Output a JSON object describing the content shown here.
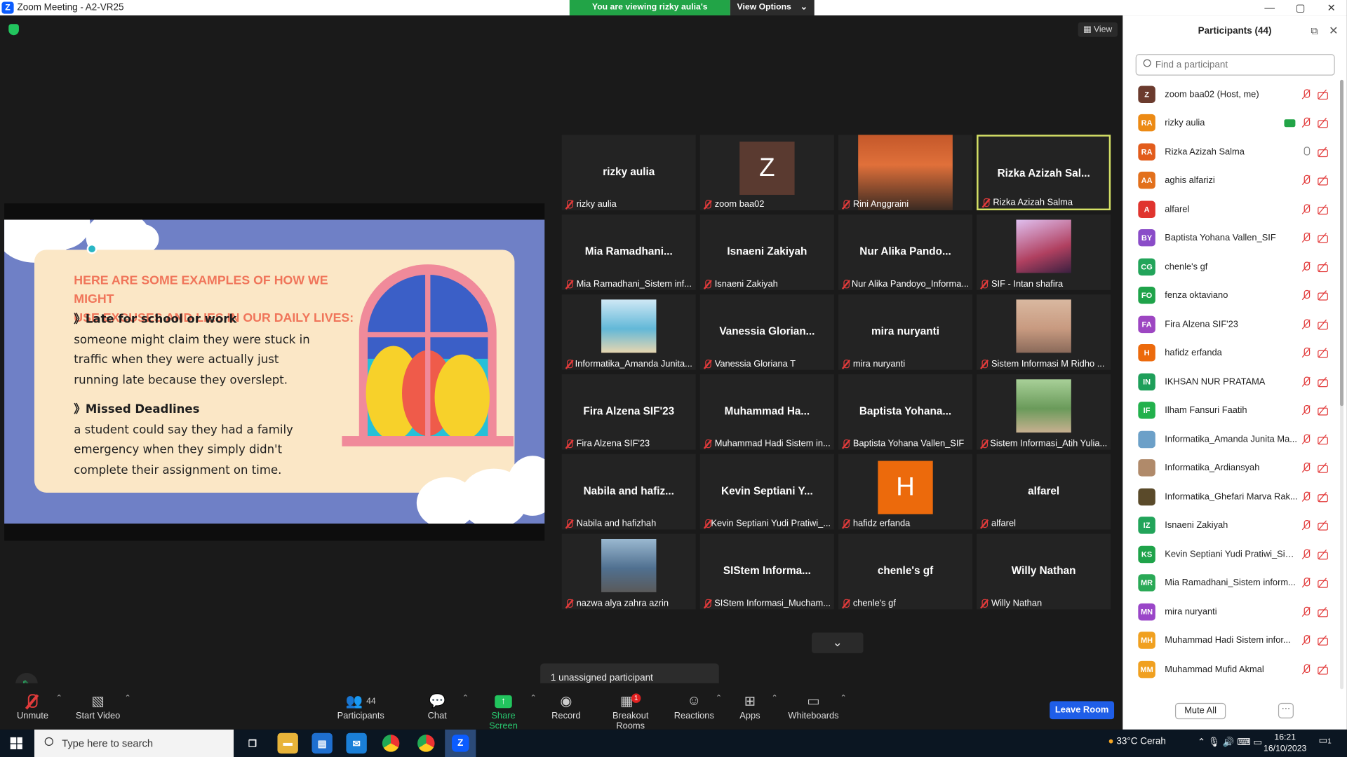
{
  "window": {
    "title": "Zoom Meeting - A2-VR25",
    "min": "—",
    "max": "▢",
    "close": "✕"
  },
  "banner": {
    "viewing": "You are viewing rizky aulia's screen",
    "view_options": "View Options",
    "caret": "⌄"
  },
  "view_button": "View",
  "slide": {
    "heading_line1": "HERE ARE SOME EXAMPLES OF HOW WE MIGHT",
    "heading_line2": "USE EXCUSES AND LIES IN OUR DAILY LIVES:",
    "point1_title": "》Late for school or work",
    "point1_l1": "someone might claim they were stuck in",
    "point1_l2": "traffic when they were actually just",
    "point1_l3": "running late because they overslept.",
    "point2_title": "》Missed Deadlines",
    "point2_l1": "a student could say they had a family",
    "point2_l2": "emergency when they simply didn't",
    "point2_l3": "complete their assignment on time."
  },
  "tiles": [
    {
      "big": "rizky aulia",
      "label": "rizky aulia"
    },
    {
      "big": "Z",
      "label": "zoom baa02",
      "avatar_color": "#5a3a30"
    },
    {
      "big": "",
      "label": "Rini Anggraini",
      "photo": "room"
    },
    {
      "big": "Rizka Azizah Sal...",
      "label": "Rizka Azizah Salma",
      "active": true
    },
    {
      "big": "Mia  Ramadhani...",
      "label": "Mia Ramadhani_Sistem inf..."
    },
    {
      "big": "Isnaeni Zakiyah",
      "label": "Isnaeni Zakiyah"
    },
    {
      "big": "Nur Alika Pando...",
      "label": "Nur Alika Pandoyo_Informa..."
    },
    {
      "big": "",
      "label": "SIF - Intan shafira",
      "photo": "anime"
    },
    {
      "big": "",
      "label": "Informatika_Amanda Junita...",
      "photo": "beach"
    },
    {
      "big": "Vanessia  Glorian...",
      "label": "Vanessia Gloriana T"
    },
    {
      "big": "mira nuryanti",
      "label": "mira nuryanti"
    },
    {
      "big": "",
      "label": "Sistem Informasi M Ridho ...",
      "photo": "portrait"
    },
    {
      "big": "Fira Alzena SIF'23",
      "label": "Fira Alzena SIF'23"
    },
    {
      "big": "Muhammad  Ha...",
      "label": "Muhammad Hadi Sistem in..."
    },
    {
      "big": "Baptista Yohana...",
      "label": "Baptista Yohana Vallen_SIF"
    },
    {
      "big": "",
      "label": "Sistem Informasi_Atih Yulia...",
      "photo": "park"
    },
    {
      "big": "Nabila  and  hafiz...",
      "label": "Nabila and hafizhah"
    },
    {
      "big": "Kevin Septiani Y...",
      "label": "Kevin Septiani Yudi Pratiwi_..."
    },
    {
      "big": "H",
      "label": "hafidz erfanda",
      "avatar_color": "#ec6a0c"
    },
    {
      "big": "alfarel",
      "label": "alfarel"
    },
    {
      "big": "",
      "label": "nazwa alya zahra azrin",
      "photo": "car"
    },
    {
      "big": "SIStem  Informa...",
      "label": "SIStem Informasi_Mucham..."
    },
    {
      "big": "chenle's gf",
      "label": "chenle's gf"
    },
    {
      "big": "Willy Nathan",
      "label": "Willy Nathan"
    }
  ],
  "grid_more": "⌄",
  "unassigned": "1 unassigned participant",
  "toolbar": {
    "unmute": "Unmute",
    "start_video": "Start Video",
    "participants": "Participants",
    "participants_count": "44",
    "chat": "Chat",
    "share_screen": "Share Screen",
    "record": "Record",
    "breakout": "Breakout Rooms",
    "breakout_badge": "1",
    "reactions": "Reactions",
    "apps": "Apps",
    "whiteboards": "Whiteboards",
    "leave": "Leave Room",
    "caret": "⌃"
  },
  "panel": {
    "title": "Participants (44)",
    "search_placeholder": "Find a participant",
    "mute_all": "Mute All",
    "more": "···",
    "participants": [
      {
        "initials": "Z",
        "name": "zoom baa02 (Host, me)",
        "color": "#6b3b2e"
      },
      {
        "initials": "RA",
        "name": "rizky aulia",
        "color": "#ec8a14",
        "sharing": true
      },
      {
        "initials": "RA",
        "name": "Rizka Azizah Salma",
        "color": "#e25c1c",
        "mic_on": true
      },
      {
        "initials": "AA",
        "name": "aghis alfarizi",
        "color": "#e2701c"
      },
      {
        "initials": "A",
        "name": "alfarel",
        "color": "#e0342e"
      },
      {
        "initials": "BY",
        "name": "Baptista Yohana Vallen_SIF",
        "color": "#8a4cc8"
      },
      {
        "initials": "CG",
        "name": "chenle's gf",
        "color": "#22a45a"
      },
      {
        "initials": "FO",
        "name": "fenza oktaviano",
        "color": "#1fa34a"
      },
      {
        "initials": "FA",
        "name": "Fira Alzena SIF'23",
        "color": "#9d46c2"
      },
      {
        "initials": "H",
        "name": "hafidz erfanda",
        "color": "#ec6a0c"
      },
      {
        "initials": "IN",
        "name": "IKHSAN NUR PRATAMA",
        "color": "#1e9f5a"
      },
      {
        "initials": "IF",
        "name": "Ilham Fansuri Faatih",
        "color": "#22b14c"
      },
      {
        "initials": "",
        "name": "Informatika_Amanda Junita Ma...",
        "color": "#6ca0c8"
      },
      {
        "initials": "",
        "name": "Informatika_Ardiansyah",
        "color": "#b08a6a"
      },
      {
        "initials": "",
        "name": "Informatika_Ghefari Marva Rak...",
        "color": "#5a4a2a"
      },
      {
        "initials": "IZ",
        "name": "Isnaeni Zakiyah",
        "color": "#22a45a"
      },
      {
        "initials": "KS",
        "name": "Kevin Septiani Yudi Pratiwi_Sist...",
        "color": "#1fa34a"
      },
      {
        "initials": "MR",
        "name": "Mia Ramadhani_Sistem inform...",
        "color": "#2aa956"
      },
      {
        "initials": "MN",
        "name": "mira nuryanti",
        "color": "#9a46c8"
      },
      {
        "initials": "MH",
        "name": "Muhammad Hadi Sistem infor...",
        "color": "#f0a020"
      },
      {
        "initials": "MM",
        "name": "Muhammad Mufid Akmal",
        "color": "#f0a020"
      }
    ]
  },
  "taskbar": {
    "search": "Type here to search",
    "weather": "33°C  Cerah",
    "time": "16:21",
    "date": "16/10/2023",
    "notif": "1"
  }
}
